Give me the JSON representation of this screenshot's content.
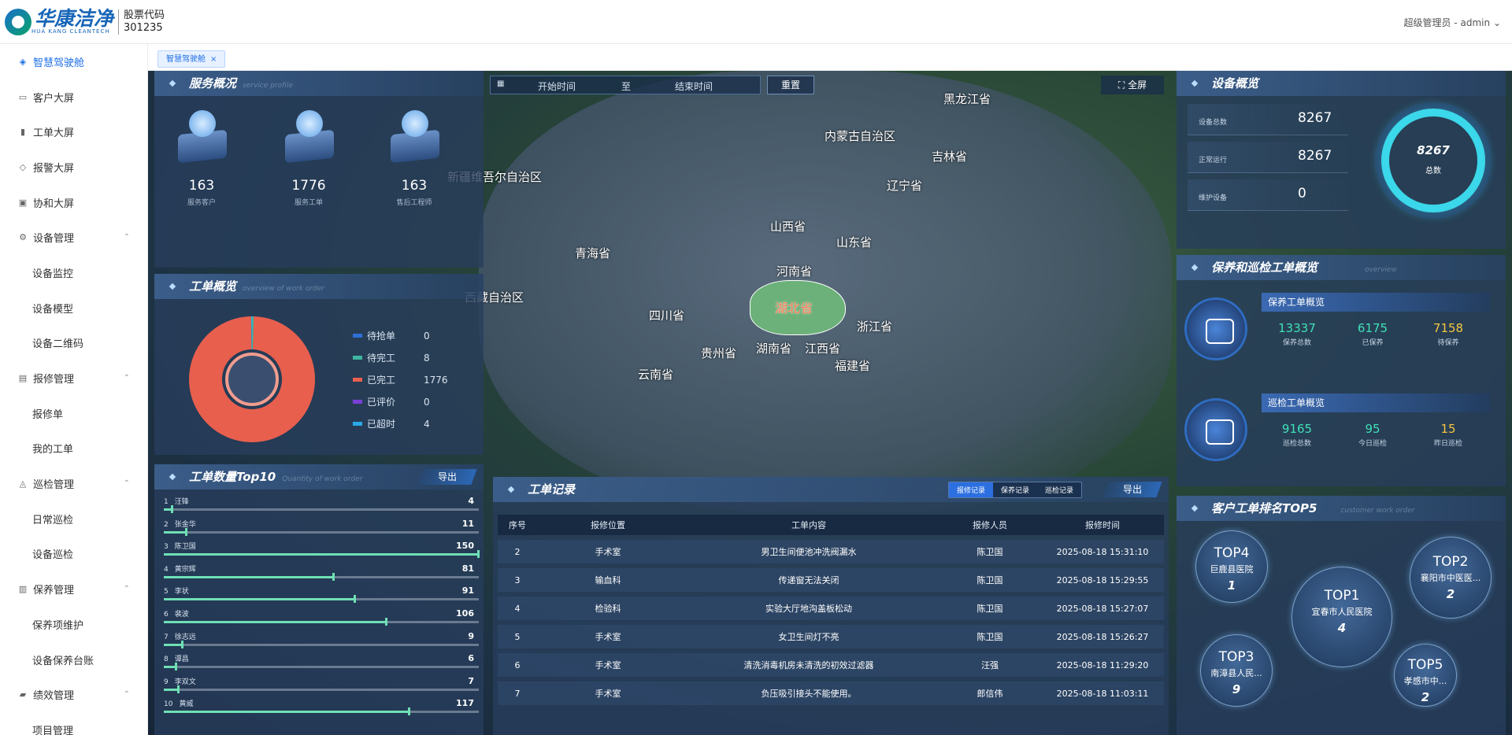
{
  "header": {
    "logo_cn": "华康洁净",
    "logo_en": "HUA KANG CLEANTECH",
    "stock_label": "股票代码",
    "stock_code": "301235",
    "user": "超级管理员 - admin"
  },
  "sidebar": {
    "items": [
      {
        "label": "智慧驾驶舱",
        "icon": "dashboard-icon"
      },
      {
        "label": "客户大屏",
        "icon": "monitor-icon"
      },
      {
        "label": "工单大屏",
        "icon": "chart-icon"
      },
      {
        "label": "报警大屏",
        "icon": "bell-icon"
      },
      {
        "label": "协和大屏",
        "icon": "screen-icon"
      },
      {
        "label": "设备管理",
        "icon": "device-icon"
      },
      {
        "label": "设备监控"
      },
      {
        "label": "设备模型"
      },
      {
        "label": "设备二维码"
      },
      {
        "label": "报修管理",
        "icon": "repair-icon"
      },
      {
        "label": "报修单"
      },
      {
        "label": "我的工单"
      },
      {
        "label": "巡检管理",
        "icon": "inspect-icon"
      },
      {
        "label": "日常巡检"
      },
      {
        "label": "设备巡检"
      },
      {
        "label": "保养管理",
        "icon": "maintain-icon"
      },
      {
        "label": "保养项维护"
      },
      {
        "label": "设备保养台账"
      },
      {
        "label": "绩效管理",
        "icon": "folder-icon"
      },
      {
        "label": "项目管理"
      }
    ]
  },
  "tab": {
    "label": "智慧驾驶舱",
    "close": "×"
  },
  "toolbar": {
    "start": "开始时间",
    "to": "至",
    "end": "结束时间",
    "reset": "重置",
    "fullscreen": "全屏"
  },
  "service": {
    "title": "服务概况",
    "watermark": "service profile",
    "stats": [
      {
        "value": "163",
        "label": "服务客户"
      },
      {
        "value": "1776",
        "label": "服务工单"
      },
      {
        "value": "163",
        "label": "售后工程师"
      }
    ]
  },
  "workorder": {
    "title": "工单概览",
    "watermark": "overview of work order",
    "legend": [
      {
        "label": "待抢单",
        "value": "0",
        "color": "#2f6fd8"
      },
      {
        "label": "待完工",
        "value": "8",
        "color": "#3fb7a0"
      },
      {
        "label": "已完工",
        "value": "1776",
        "color": "#e85f4e"
      },
      {
        "label": "已评价",
        "value": "0",
        "color": "#7b3fd8"
      },
      {
        "label": "已超时",
        "value": "4",
        "color": "#2aa9e8"
      }
    ]
  },
  "top10": {
    "title": "工单数量Top10",
    "watermark": "Quantity of work order",
    "export": "导出",
    "max": 150,
    "rows": [
      {
        "rank": "1",
        "name": "汪锋",
        "value": 4
      },
      {
        "rank": "2",
        "name": "张金华",
        "value": 11
      },
      {
        "rank": "3",
        "name": "陈卫国",
        "value": 150
      },
      {
        "rank": "4",
        "name": "黄宗辉",
        "value": 81
      },
      {
        "rank": "5",
        "name": "李状",
        "value": 91
      },
      {
        "rank": "6",
        "name": "裴波",
        "value": 106
      },
      {
        "rank": "7",
        "name": "徐志远",
        "value": 9
      },
      {
        "rank": "8",
        "name": "谭昌",
        "value": 6
      },
      {
        "rank": "9",
        "name": "李双文",
        "value": 7
      },
      {
        "rank": "10",
        "name": "黄威",
        "value": 117
      }
    ]
  },
  "map": {
    "provinces": [
      {
        "name": "新疆维吾尔自治区"
      },
      {
        "name": "内蒙古自治区"
      },
      {
        "name": "黑龙江省"
      },
      {
        "name": "吉林省"
      },
      {
        "name": "辽宁省"
      },
      {
        "name": "山西省"
      },
      {
        "name": "山东省"
      },
      {
        "name": "青海省"
      },
      {
        "name": "河南省"
      },
      {
        "name": "西藏自治区"
      },
      {
        "name": "四川省"
      },
      {
        "name": "浙江省"
      },
      {
        "name": "湖南省"
      },
      {
        "name": "江西省"
      },
      {
        "name": "贵州省"
      },
      {
        "name": "福建省"
      },
      {
        "name": "云南省"
      }
    ],
    "highlight": "湖北省"
  },
  "records": {
    "title": "工单记录",
    "export": "导出",
    "tabs": [
      "报修记录",
      "保养记录",
      "巡检记录"
    ],
    "columns": [
      "序号",
      "报修位置",
      "工单内容",
      "报修人员",
      "报修时间"
    ],
    "rows": [
      [
        "2",
        "手术室",
        "男卫生间便池冲洗阀漏水",
        "陈卫国",
        "2025-08-18 15:31:10"
      ],
      [
        "3",
        "输血科",
        "传递窗无法关闭",
        "陈卫国",
        "2025-08-18 15:29:55"
      ],
      [
        "4",
        "检验科",
        "实验大厅地沟盖板松动",
        "陈卫国",
        "2025-08-18 15:27:07"
      ],
      [
        "5",
        "手术室",
        "女卫生间灯不亮",
        "陈卫国",
        "2025-08-18 15:26:27"
      ],
      [
        "6",
        "手术室",
        "清洗消毒机房未清洗的初效过滤器",
        "汪强",
        "2025-08-18 11:29:20"
      ],
      [
        "7",
        "手术室",
        "负压吸引接头不能使用。",
        "郎信伟",
        "2025-08-18 11:03:11"
      ]
    ]
  },
  "devices": {
    "title": "设备概览",
    "rows": [
      {
        "label": "设备总数",
        "value": "8267"
      },
      {
        "label": "正常运行",
        "value": "8267"
      },
      {
        "label": "维护设备",
        "value": "0"
      }
    ],
    "ring_value": "8267",
    "ring_label": "总数"
  },
  "maintain": {
    "title": "保养和巡检工单概览",
    "watermark": "overview",
    "cards": [
      {
        "head": "保养工单概览",
        "cells": [
          {
            "value": "13337",
            "label": "保养总数",
            "color": "#3fe0b8"
          },
          {
            "value": "6175",
            "label": "已保养",
            "color": "#3fe0b8"
          },
          {
            "value": "7158",
            "label": "待保养",
            "color": "#f5c542"
          }
        ]
      },
      {
        "head": "巡检工单概览",
        "cells": [
          {
            "value": "9165",
            "label": "巡检总数",
            "color": "#3fe0b8"
          },
          {
            "value": "95",
            "label": "今日巡检",
            "color": "#3fe0b8"
          },
          {
            "value": "15",
            "label": "昨日巡检",
            "color": "#f5c542"
          }
        ]
      }
    ]
  },
  "top5": {
    "title": "客户工单排名TOP5",
    "watermark": "customer work order",
    "items": [
      {
        "rank": "TOP4",
        "name": "巨鹿县医院",
        "count": "1"
      },
      {
        "rank": "TOP2",
        "name": "襄阳市中医医...",
        "count": "2"
      },
      {
        "rank": "TOP1",
        "name": "宜春市人民医院",
        "count": "4"
      },
      {
        "rank": "TOP3",
        "name": "南漳县人民...",
        "count": "9"
      },
      {
        "rank": "TOP5",
        "name": "孝感市中...",
        "count": "2"
      }
    ]
  }
}
